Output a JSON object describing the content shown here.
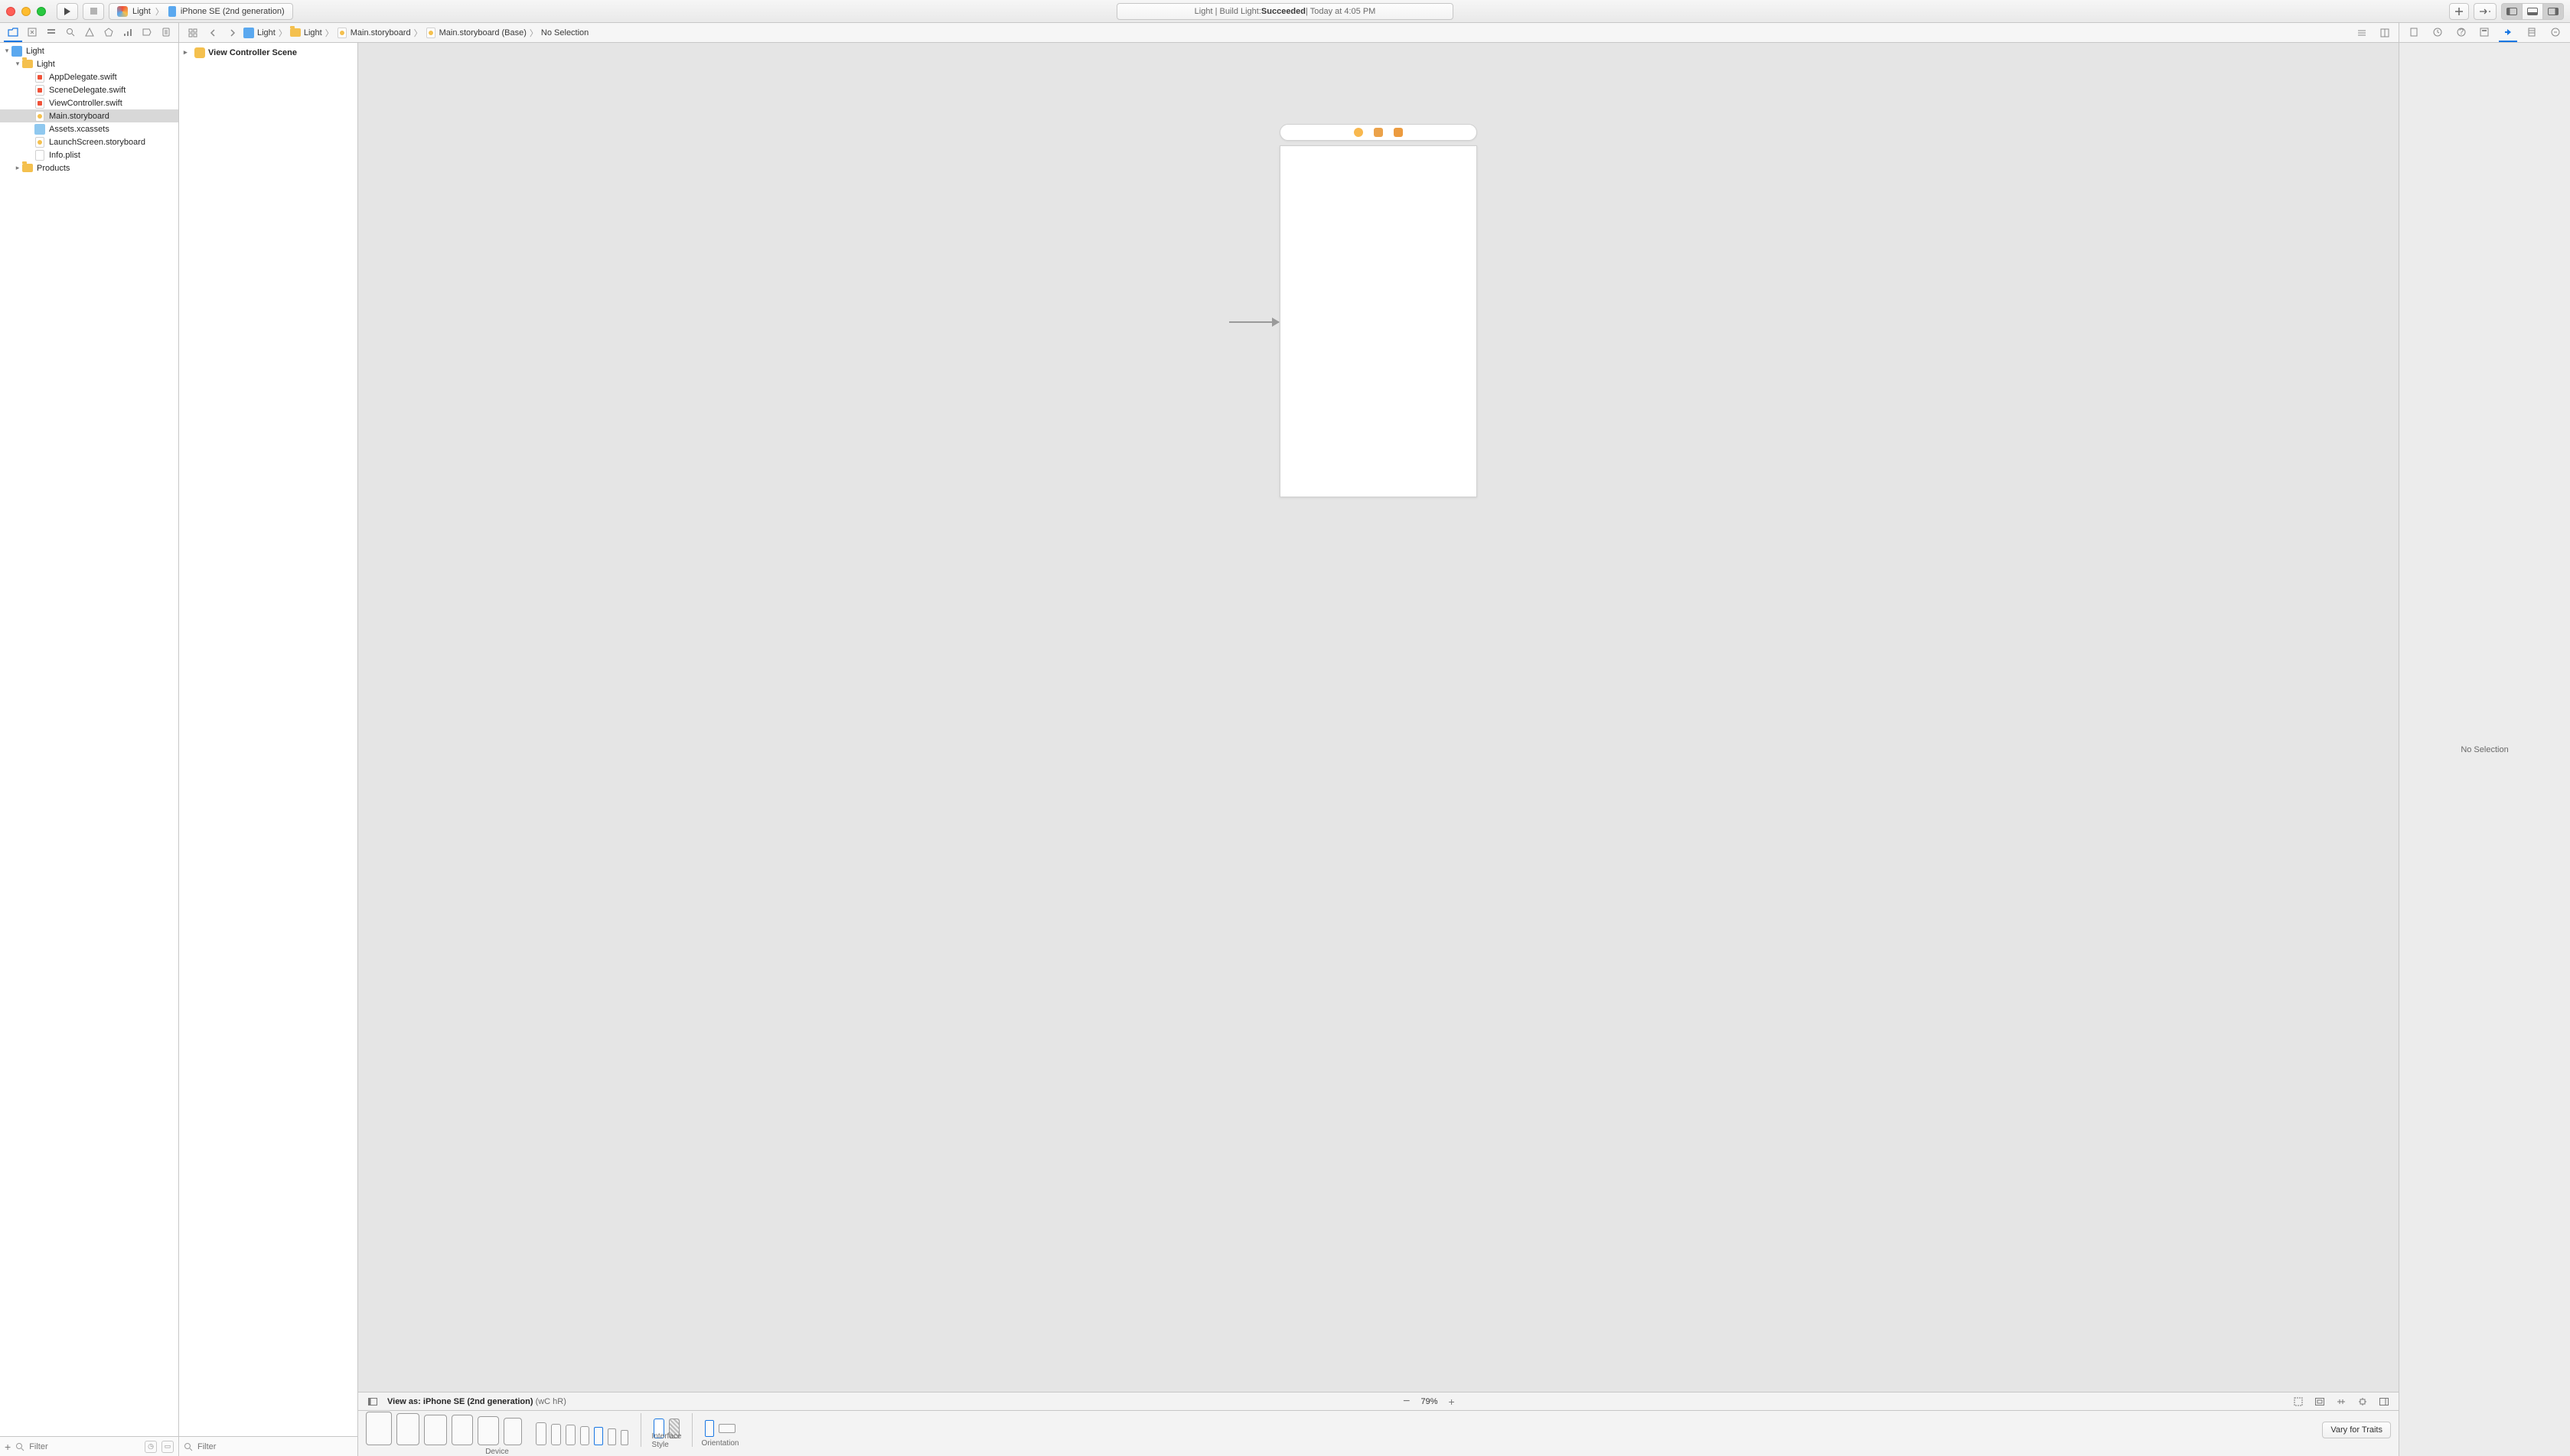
{
  "titlebar": {
    "scheme_target": "Light",
    "scheme_device": "iPhone SE (2nd generation)",
    "activity_prefix": "Light | Build Light: ",
    "activity_status": "Succeeded",
    "activity_suffix": " | Today at 4:05 PM"
  },
  "jumpbar": {
    "crumbs": [
      "Light",
      "Light",
      "Main.storyboard",
      "Main.storyboard (Base)",
      "No Selection"
    ]
  },
  "navigator": {
    "items": [
      {
        "label": "Light",
        "kind": "proj",
        "indent": 0,
        "disc": "▾"
      },
      {
        "label": "Light",
        "kind": "folder",
        "indent": 1,
        "disc": "▾"
      },
      {
        "label": "AppDelegate.swift",
        "kind": "swift",
        "indent": 2,
        "disc": ""
      },
      {
        "label": "SceneDelegate.swift",
        "kind": "swift",
        "indent": 2,
        "disc": ""
      },
      {
        "label": "ViewController.swift",
        "kind": "swift",
        "indent": 2,
        "disc": ""
      },
      {
        "label": "Main.storyboard",
        "kind": "story",
        "indent": 2,
        "disc": "",
        "selected": true
      },
      {
        "label": "Assets.xcassets",
        "kind": "assets",
        "indent": 2,
        "disc": ""
      },
      {
        "label": "LaunchScreen.storyboard",
        "kind": "story",
        "indent": 2,
        "disc": ""
      },
      {
        "label": "Info.plist",
        "kind": "plist",
        "indent": 2,
        "disc": ""
      },
      {
        "label": "Products",
        "kind": "folder",
        "indent": 1,
        "disc": "▸"
      }
    ],
    "filter_placeholder": "Filter"
  },
  "outline": {
    "scene_label": "View Controller Scene",
    "filter_placeholder": "Filter"
  },
  "canvas": {
    "view_as_prefix": "View as: ",
    "view_as_device": "iPhone SE (2nd generation)",
    "view_as_traits": " (wC hR)",
    "zoom": "79%"
  },
  "devicebar": {
    "vary_label": "Vary for Traits",
    "group_device": "Device",
    "group_style": "Interface Style",
    "group_orientation": "Orientation"
  },
  "inspector": {
    "empty": "No Selection"
  }
}
